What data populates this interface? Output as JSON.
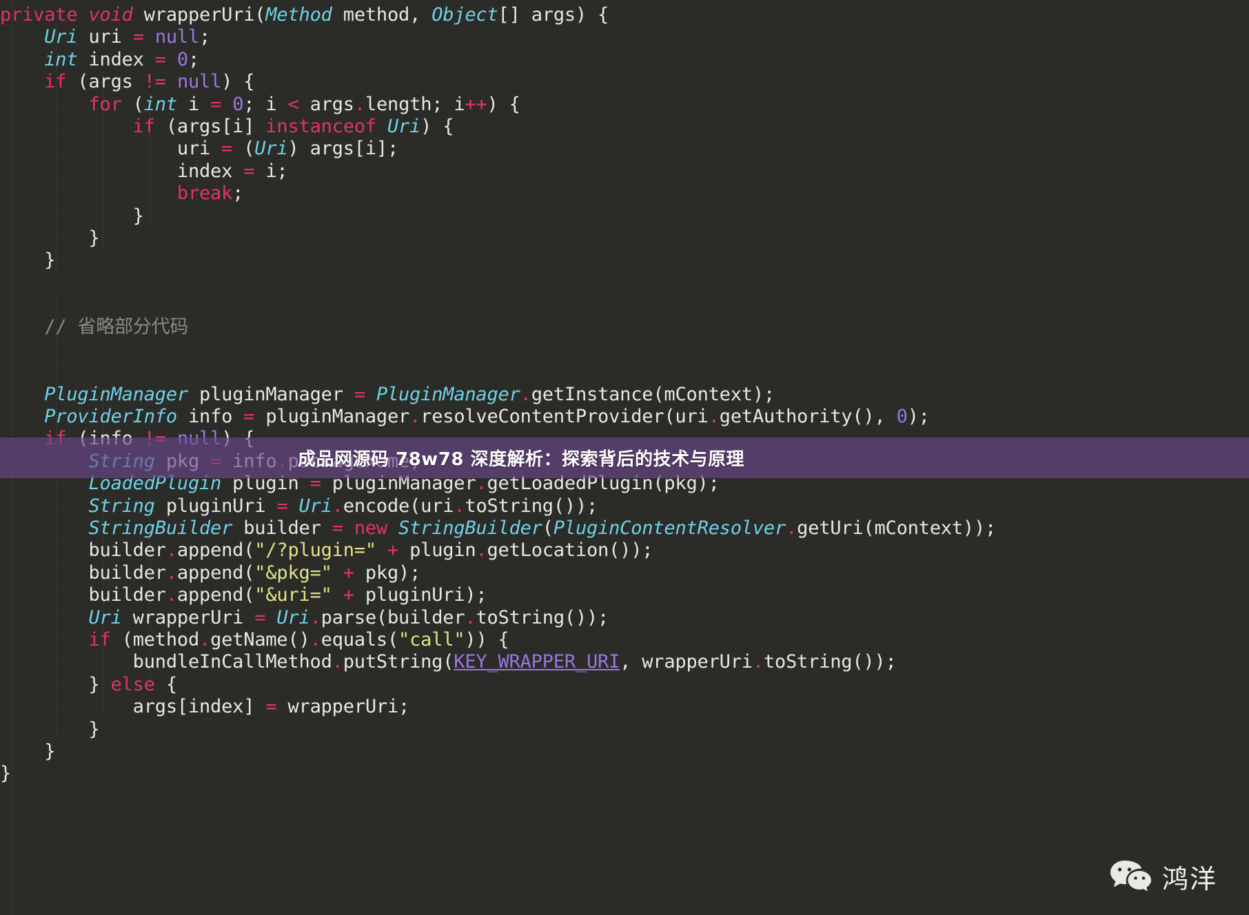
{
  "editor": {
    "language": "java",
    "background_color": "#2b2b28",
    "foreground_color": "#e8e8e3",
    "colors": {
      "keyword": "#e3326a",
      "type": "#6fd2e8",
      "literal": "#9a77e0",
      "string": "#e3e38a",
      "comment": "#8a8a82",
      "constant": "#9a77e0",
      "operator": "#e3326a"
    },
    "code_lines": [
      "private void wrapperUri(Method method, Object[] args) {",
      "    Uri uri = null;",
      "    int index = 0;",
      "    if (args != null) {",
      "        for (int i = 0; i < args.length; i++) {",
      "            if (args[i] instanceof Uri) {",
      "                uri = (Uri) args[i];",
      "                index = i;",
      "                break;",
      "            }",
      "        }",
      "    }",
      "",
      "    // 省略部分代码",
      "",
      "    PluginManager pluginManager = PluginManager.getInstance(mContext);",
      "    ProviderInfo info = pluginManager.resolveContentProvider(uri.getAuthority(), 0);",
      "    if (info != null) {",
      "        String pkg = info.packageName;",
      "        LoadedPlugin plugin = pluginManager.getLoadedPlugin(pkg);",
      "        String pluginUri = Uri.encode(uri.toString());",
      "        StringBuilder builder = new StringBuilder(PluginContentResolver.getUri(mContext));",
      "        builder.append(\"/?plugin=\" + plugin.getLocation());",
      "        builder.append(\"&pkg=\" + pkg);",
      "        builder.append(\"&uri=\" + pluginUri);",
      "        Uri wrapperUri = Uri.parse(builder.toString());",
      "        if (method.getName().equals(\"call\")) {",
      "            bundleInCallMethod.putString(KEY_WRAPPER_URI, wrapperUri.toString());",
      "        } else {",
      "            args[index] = wrapperUri;",
      "        }",
      "    }",
      "}"
    ]
  },
  "banner": {
    "title": "成品网源码 78w78 深度解析：探索背后的技术与原理",
    "background_color": "#6a488c",
    "text_color": "#ffffff"
  },
  "watermark": {
    "icon": "wechat-icon",
    "label": "鸿洋"
  }
}
